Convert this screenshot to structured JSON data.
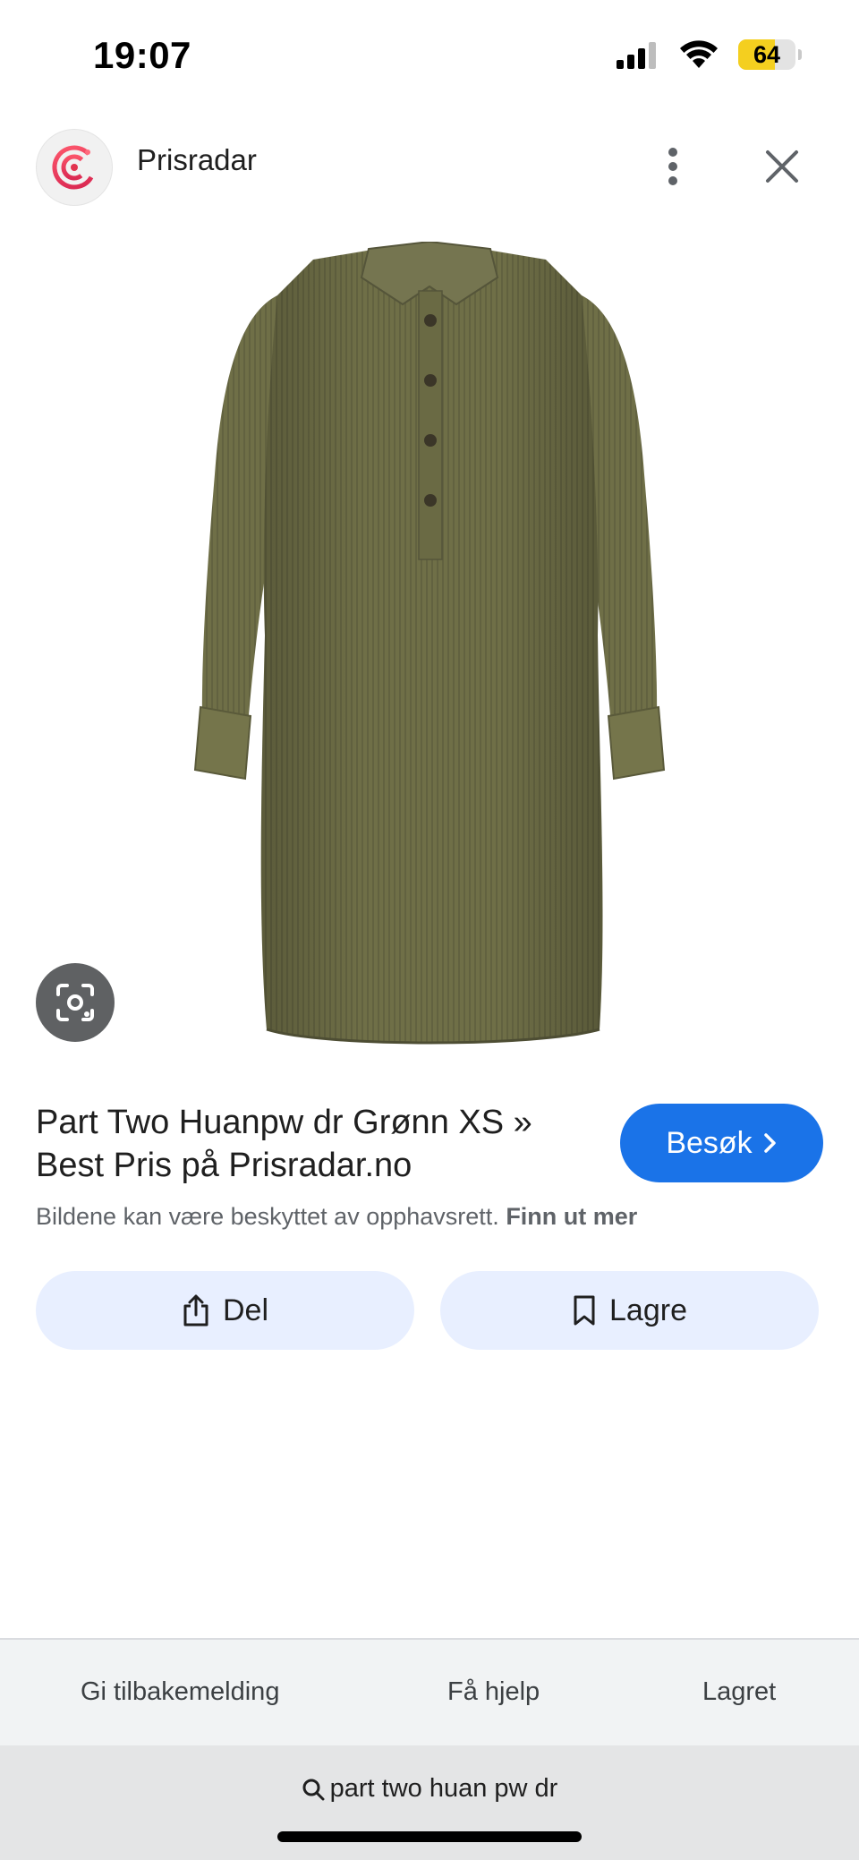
{
  "status_bar": {
    "time": "19:07",
    "battery_level": "64",
    "icons": [
      "cellular-signal-icon",
      "wifi-icon",
      "battery-icon"
    ]
  },
  "header": {
    "site_name": "Prisradar",
    "logo_icon": "prisradar-logo",
    "more_icon": "more-vertical-icon",
    "close_icon": "close-icon"
  },
  "product": {
    "image_alt": "green corduroy shirt dress",
    "lens_icon": "google-lens-icon",
    "title": "Part Two Huanpw dr Grønn XS » Best Pris på Prisradar.no",
    "visit_label": "Besøk",
    "visit_icon": "chevron-right-icon",
    "copyright_text": "Bildene kan være beskyttet av opphavsrett.",
    "copyright_link": "Finn ut mer"
  },
  "actions": {
    "share_label": "Del",
    "share_icon": "share-icon",
    "save_label": "Lagre",
    "save_icon": "bookmark-icon"
  },
  "bottom_bar": {
    "feedback_label": "Gi tilbakemelding",
    "help_label": "Få hjelp",
    "saved_label": "Lagret"
  },
  "search": {
    "query": "part two huan pw dr",
    "icon": "search-icon"
  },
  "colors": {
    "accent": "#1a73e8",
    "action_button_bg": "#e8efff",
    "dress_green": "#6e6e46",
    "battery": "#f4cf1f"
  }
}
